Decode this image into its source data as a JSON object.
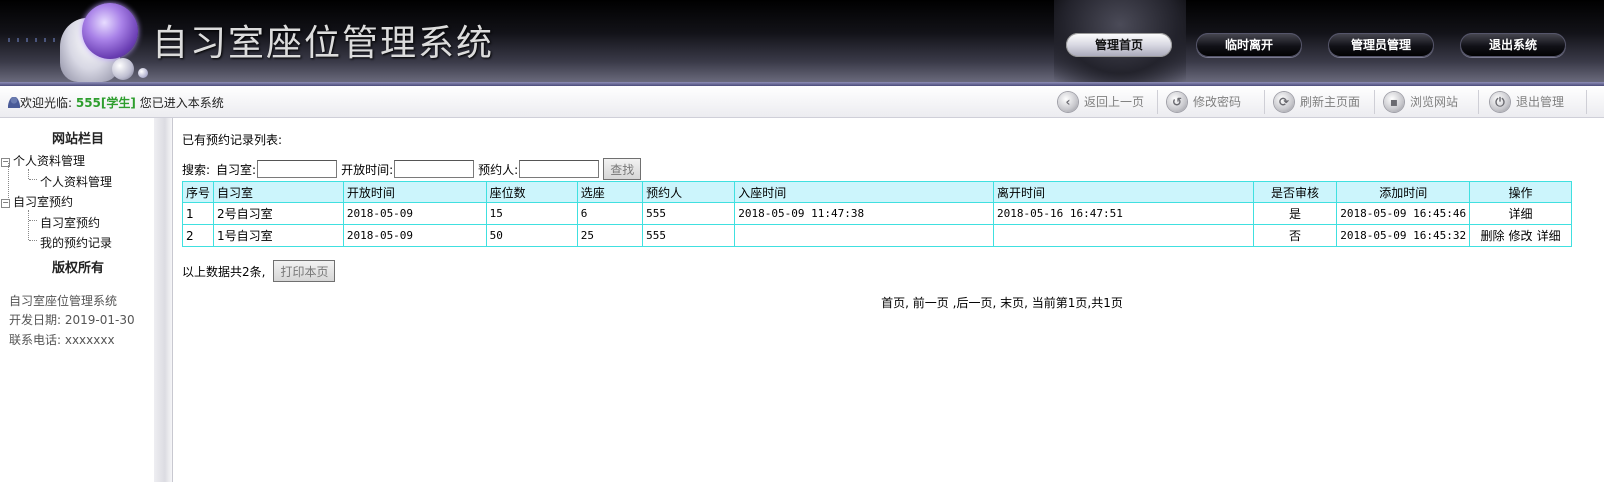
{
  "header": {
    "title": "自习室座位管理系统",
    "nav": [
      "管理首页",
      "临时离开",
      "管理员管理",
      "退出系统"
    ]
  },
  "toolbar": {
    "welcome_prefix": "欢迎光临: ",
    "username": "555[学生]",
    "welcome_suffix": " 您已进入本系统",
    "buttons": [
      {
        "label": "返回上一页",
        "icon": "back-icon"
      },
      {
        "label": "修改密码",
        "icon": "password-icon"
      },
      {
        "label": "刷新主页面",
        "icon": "refresh-icon"
      },
      {
        "label": "浏览网站",
        "icon": "browse-icon"
      },
      {
        "label": "退出管理",
        "icon": "power-icon"
      }
    ]
  },
  "sidebar": {
    "title": "网站栏目",
    "groups": [
      {
        "label": "个人资料管理",
        "children": [
          "个人资料管理"
        ]
      },
      {
        "label": "自习室预约",
        "children": [
          "自习室预约",
          "我的预约记录"
        ]
      }
    ],
    "copyright_title": "版权所有",
    "info": [
      "自习室座位管理系统",
      "开发日期: 2019-01-30",
      "联系电话: xxxxxxx"
    ]
  },
  "main": {
    "caption": "已有预约记录列表:",
    "search": {
      "label": "搜索:",
      "fields": [
        {
          "label": "自习室:",
          "value": ""
        },
        {
          "label": "开放时间:",
          "value": ""
        },
        {
          "label": "预约人:",
          "value": ""
        }
      ],
      "button": "查找"
    },
    "table": {
      "columns": [
        "序号",
        "自习室",
        "开放时间",
        "座位数",
        "选座",
        "预约人",
        "入座时间",
        "离开时间",
        "是否审核",
        "添加时间",
        "操作"
      ],
      "rows": [
        {
          "cells": [
            "1",
            "2号自习室",
            "2018-05-09",
            "15",
            "6",
            "555",
            "2018-05-09 11:47:38",
            "2018-05-16 16:47:51",
            "是",
            "2018-05-09 16:45:46"
          ],
          "actions": [
            "详细"
          ]
        },
        {
          "cells": [
            "2",
            "1号自习室",
            "2018-05-09",
            "50",
            "25",
            "555",
            "",
            "",
            "否",
            "2018-05-09 16:45:32"
          ],
          "actions": [
            "删除",
            "修改",
            "详细"
          ]
        }
      ]
    },
    "total_text": "以上数据共2条,",
    "print_button": "打印本页",
    "pager": {
      "first": "首页,",
      "prev": "前一页",
      "next": ",后一页,",
      "last": "末页,",
      "status": "当前第1页,共1页"
    }
  }
}
